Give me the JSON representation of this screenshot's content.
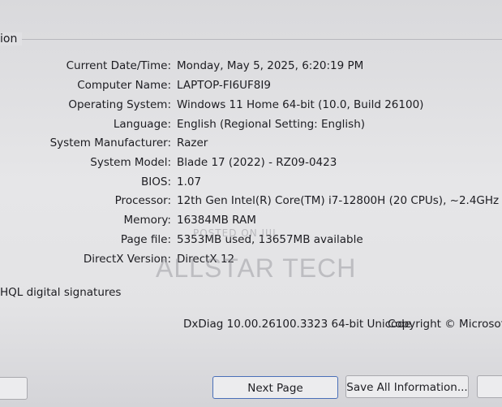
{
  "group": {
    "title": "ion"
  },
  "system_info": [
    {
      "label": "Current Date/Time:",
      "value": "Monday, May 5, 2025, 6:20:19 PM"
    },
    {
      "label": "Computer Name:",
      "value": "LAPTOP-FI6UF8I9"
    },
    {
      "label": "Operating System:",
      "value": "Windows 11 Home 64-bit (10.0, Build 26100)"
    },
    {
      "label": "Language:",
      "value": "English (Regional Setting: English)"
    },
    {
      "label": "System Manufacturer:",
      "value": "Razer"
    },
    {
      "label": "System Model:",
      "value": "Blade 17 (2022) - RZ09-0423"
    },
    {
      "label": "BIOS:",
      "value": "1.07"
    },
    {
      "label": "Processor:",
      "value": "12th Gen Intel(R) Core(TM) i7-12800H (20 CPUs), ~2.4GHz"
    },
    {
      "label": "Memory:",
      "value": "16384MB RAM"
    },
    {
      "label": "Page file:",
      "value": "5353MB used, 13657MB available"
    },
    {
      "label": "DirectX Version:",
      "value": "DirectX 12"
    }
  ],
  "whql_checkbox": {
    "label": "HQL digital signatures"
  },
  "footer": {
    "version": "DxDiag 10.00.26100.3323 64-bit Unicode",
    "copyright": "Copyright © Microsoft."
  },
  "watermark": {
    "small": "POSTED ON JIJI",
    "large": "ALLSTAR TECH"
  },
  "buttons": {
    "next_page": "Next Page",
    "save_all": "Save All Information..."
  }
}
